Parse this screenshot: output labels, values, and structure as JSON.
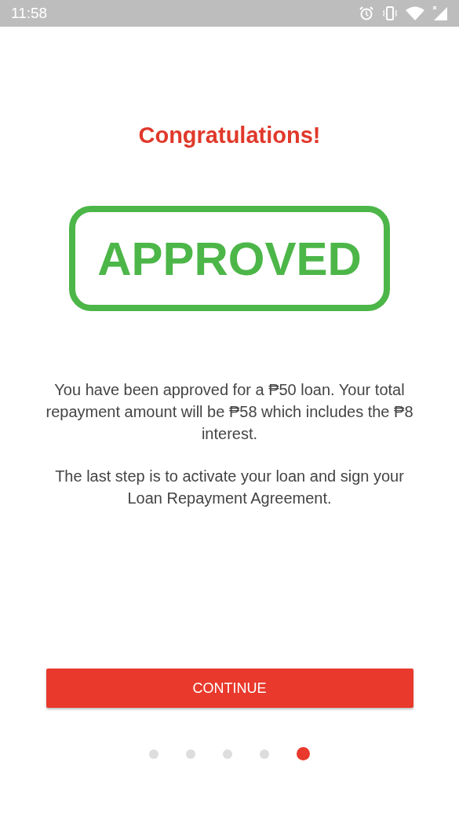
{
  "status_bar": {
    "time": "11:58"
  },
  "title": "Congratulations!",
  "stamp": "APPROVED",
  "paragraphs": [
    "You have been approved for a ₱50 loan. Your total repayment amount will be ₱58 which includes the ₱8 interest.",
    "The last step is to activate your loan and sign your Loan Repayment Agreement."
  ],
  "button": "CONTINUE",
  "pages": [
    {
      "selected": false
    },
    {
      "selected": false
    },
    {
      "selected": false
    },
    {
      "selected": false
    },
    {
      "selected": true
    }
  ]
}
